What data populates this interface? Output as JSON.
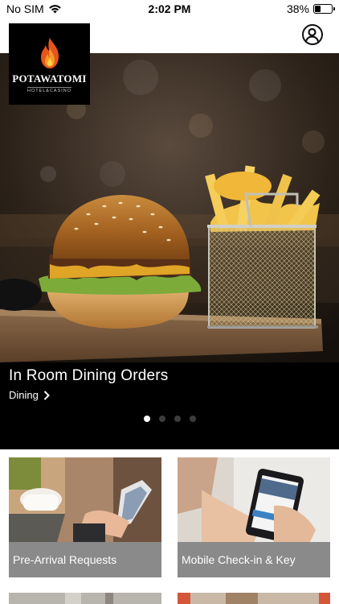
{
  "status_bar": {
    "carrier": "No SIM",
    "time": "2:02 PM",
    "battery": "38%",
    "battery_level": 0.38
  },
  "header": {
    "logo_name": "POTAWATOMI",
    "logo_sub": "HOTEL&CASINO",
    "profile_icon": "profile-icon"
  },
  "hero": {
    "title": "In Room Dining Orders",
    "category": "Dining",
    "slide_count": 4,
    "active_slide": 1
  },
  "tiles": [
    {
      "label": "Pre-Arrival Requests"
    },
    {
      "label": "Mobile Check-in & Key"
    }
  ],
  "colors": {
    "tile_label_bg": "#8a8a8a",
    "caption_bg": "#000000",
    "flame": "#e8541e"
  }
}
